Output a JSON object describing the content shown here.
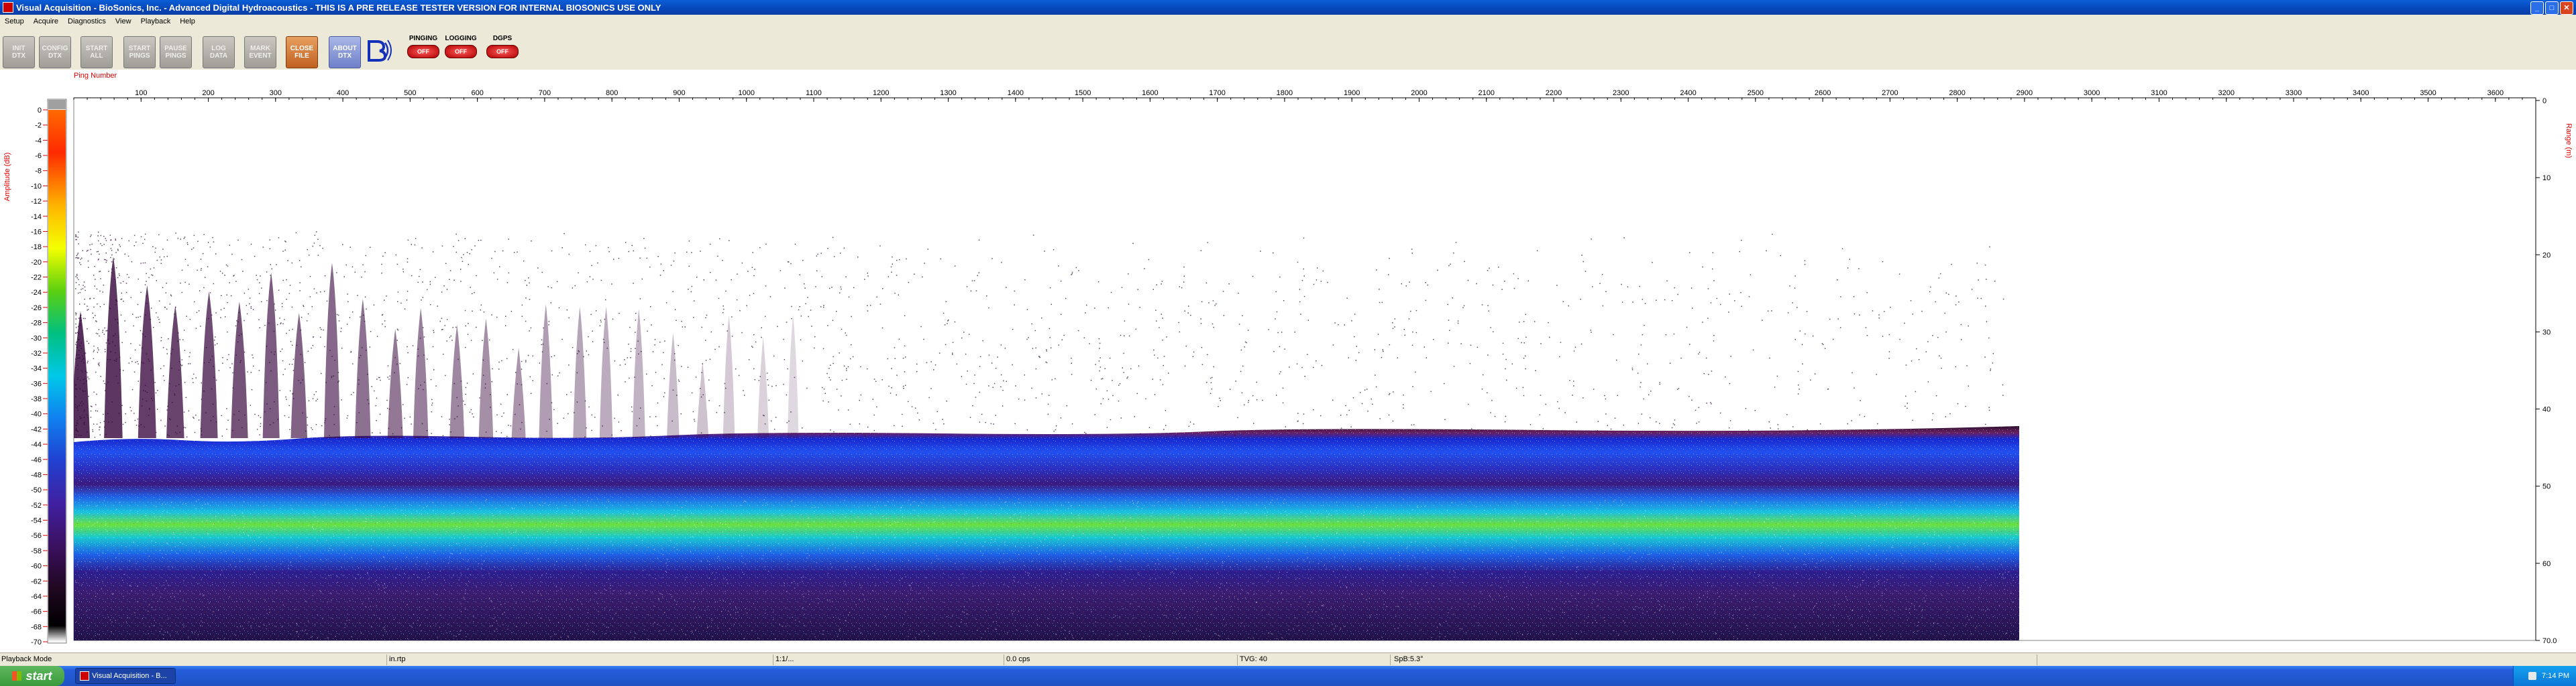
{
  "window": {
    "title": "Visual Acquisition  -  BioSonics, Inc.  -  Advanced Digital Hydroacoustics  -  THIS IS A PRE RELEASE TESTER VERSION FOR INTERNAL BIOSONICS USE ONLY",
    "minimize": "_",
    "maximize": "□",
    "close": "✕"
  },
  "menu": [
    "Setup",
    "Acquire",
    "Diagnostics",
    "View",
    "Playback",
    "Help"
  ],
  "toolbar": {
    "buttons": [
      {
        "label": "INIT\nDTX",
        "style": "gray"
      },
      {
        "label": "CONFIG\nDTX",
        "style": "gray"
      },
      {
        "label": "START\nALL",
        "style": "gray"
      },
      {
        "label": "START\nPINGS",
        "style": "gray"
      },
      {
        "label": "PAUSE\nPINGS",
        "style": "gray"
      },
      {
        "label": "LOG\nDATA",
        "style": "gray"
      },
      {
        "label": "MARK\nEVENT",
        "style": "gray"
      },
      {
        "label": "CLOSE\nFILE",
        "style": "orange"
      },
      {
        "label": "ABOUT\nDTX",
        "style": "blue"
      }
    ],
    "indicators": [
      {
        "label": "PINGING",
        "state": "OFF"
      },
      {
        "label": "LOGGING",
        "state": "OFF"
      },
      {
        "label": "DGPS",
        "state": "OFF"
      }
    ]
  },
  "echogram": {
    "x_axis_title": "Ping Number",
    "x_ticks": [
      "100",
      "200",
      "300",
      "400",
      "500",
      "600",
      "700",
      "800",
      "900",
      "1000",
      "1100",
      "1200",
      "1300",
      "1400",
      "1500",
      "1600",
      "1700",
      "1800",
      "1900",
      "2000",
      "2100",
      "2200",
      "2300",
      "2400",
      "2500",
      "2600",
      "2700",
      "2800",
      "2900",
      "3000",
      "3100",
      "3200",
      "3300",
      "3400",
      "3500",
      "3600"
    ],
    "left_axis_title": "Amplitude (dB)",
    "amplitude_ticks": [
      "0",
      "-2",
      "-4",
      "-6",
      "-8",
      "-10",
      "-12",
      "-14",
      "-16",
      "-18",
      "-20",
      "-22",
      "-24",
      "-26",
      "-28",
      "-30",
      "-32",
      "-34",
      "-36",
      "-38",
      "-40",
      "-42",
      "-44",
      "-46",
      "-48",
      "-50",
      "-52",
      "-54",
      "-56",
      "-58",
      "-60",
      "-62",
      "-64",
      "-66",
      "-68",
      "-70"
    ],
    "right_axis_title": "Range (m)",
    "range_ticks": [
      "0",
      "10",
      "20",
      "30",
      "40",
      "50",
      "60",
      "70.0"
    ],
    "colors": {
      "plot_bg": "#ffffff",
      "axis_red": "#e00000",
      "noise": "#2a1a4a",
      "bottom_band": "#1a3ad8",
      "bottom_core": "#19c8d0",
      "bottom_hot": "#7ae035",
      "sub_bottom": "#34207a"
    }
  },
  "status_bar": {
    "mode": "Playback Mode",
    "file": "in.rtp",
    "elapsed": "1:1/...",
    "pings_rate": "0.0 cps",
    "tvg": "TVG: 40",
    "spb": "SpB:5.3°"
  },
  "taskbar": {
    "start_label": "start",
    "task_label": "Visual Acquisition - B...",
    "clock": "7:14 PM"
  }
}
